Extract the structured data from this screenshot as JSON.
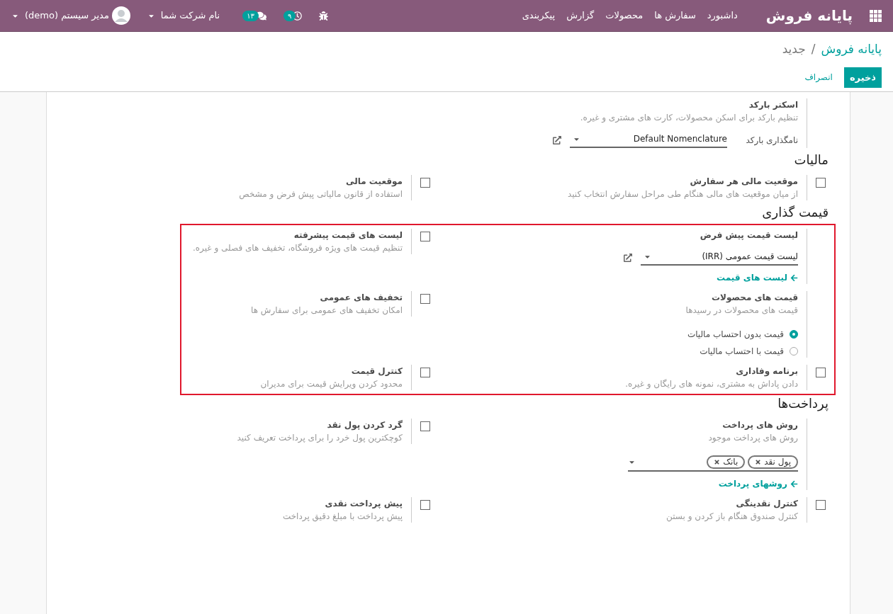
{
  "navbar": {
    "brand": "پایانه فروش",
    "menu": [
      "داشبورد",
      "سفارش ها",
      "محصولات",
      "گزارش",
      "پیکربندی"
    ],
    "activity_count": "۹",
    "message_count": "۱۳",
    "company": "نام شرکت شما",
    "user": "مدیر سیستم (demo)"
  },
  "breadcrumb": {
    "parent": "پایانه فروش",
    "separator": "/",
    "current": "جدید"
  },
  "buttons": {
    "save": "ذخیره",
    "discard": "انصراف"
  },
  "sections": [
    {
      "highlighted": false,
      "settings": [
        {
          "kind": "plain",
          "title": "اسکنر بارکد",
          "description": "تنظیم بارکد برای اسکن محصولات، کارت های مشتری و غیره.",
          "field": {
            "label": "نامگذاری بارکد",
            "value": "Default Nomenclature"
          }
        }
      ]
    },
    {
      "title": "مالیات",
      "highlighted": false,
      "settings": [
        {
          "kind": "checkbox",
          "checked": false,
          "title": "موقعیت مالی هر سفارش",
          "description": "از میان موقعیت های مالی هنگام طی مراحل سفارش انتخاب کنید"
        },
        {
          "kind": "checkbox",
          "checked": false,
          "title": "موقعیت مالی",
          "description": "استفاده از قانون مالیاتی پیش فرض و مشخص"
        }
      ]
    },
    {
      "title": "قیمت گذاری",
      "highlighted": true,
      "settings": [
        {
          "kind": "plain",
          "title": "لیست قیمت پیش فرض",
          "field": {
            "value": "لیست قیمت عمومی (IRR)"
          },
          "link": "لیست های قیمت"
        },
        {
          "kind": "checkbox",
          "checked": false,
          "title": "لیست های قیمت پیشرفته",
          "description": "تنظیم قیمت های ویژه فروشگاه، تخفیف های فصلی و غیره."
        },
        {
          "kind": "plain",
          "title": "قیمت های محصولات",
          "description": "قیمت های محصولات در رسیدها",
          "radios": [
            {
              "label": "قیمت بدون احتساب مالیات",
              "selected": true
            },
            {
              "label": "قیمت با احتساب مالیات",
              "selected": false
            }
          ]
        },
        {
          "kind": "checkbox",
          "checked": false,
          "title": "تخفیف های عمومی",
          "description": "امکان تخفیف های عمومی برای سفارش ها"
        },
        {
          "kind": "checkbox",
          "checked": false,
          "title": "برنامه وفاداری",
          "description": "دادن پاداش به مشتری، نمونه های رایگان و غیره."
        },
        {
          "kind": "checkbox",
          "checked": false,
          "title": "کنترل قیمت",
          "description": "محدود کردن ویرایش قیمت برای مدیران"
        }
      ]
    },
    {
      "title": "پرداخت‌ها",
      "highlighted": false,
      "settings": [
        {
          "kind": "plain",
          "title": "روش های پرداخت",
          "description": "روش های پرداخت موجود",
          "tags": [
            "پول نقد",
            "بانک"
          ],
          "link": "روشهای پرداخت"
        },
        {
          "kind": "checkbox",
          "checked": false,
          "title": "گرد کردن پول نقد",
          "description": "کوچکترین پول خرد را برای پرداخت تعریف کنید"
        },
        {
          "kind": "checkbox",
          "checked": false,
          "title": "کنترل نقدینگی",
          "description": "کنترل صندوق هنگام باز کردن و بستن"
        },
        {
          "kind": "checkbox",
          "checked": false,
          "title": "پیش پرداخت نقدی",
          "description": "پیش پرداخت با مبلغ دقیق پرداخت"
        }
      ]
    }
  ]
}
